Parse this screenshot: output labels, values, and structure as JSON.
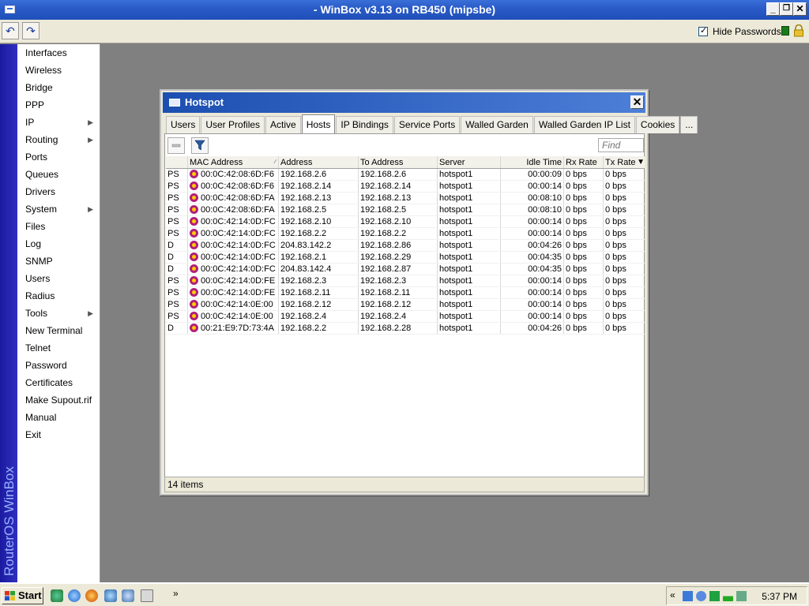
{
  "window": {
    "title": "- WinBox v3.13 on RB450 (mipsbe)"
  },
  "toolbar": {
    "hide_passwords_label": "Hide Passwords",
    "hide_passwords_checked": true
  },
  "side_strip": {
    "brand": "RouterOS WinBox"
  },
  "menu": {
    "items": [
      {
        "label": "Interfaces",
        "submenu": false
      },
      {
        "label": "Wireless",
        "submenu": false
      },
      {
        "label": "Bridge",
        "submenu": false
      },
      {
        "label": "PPP",
        "submenu": false
      },
      {
        "label": "IP",
        "submenu": true
      },
      {
        "label": "Routing",
        "submenu": true
      },
      {
        "label": "Ports",
        "submenu": false
      },
      {
        "label": "Queues",
        "submenu": false
      },
      {
        "label": "Drivers",
        "submenu": false
      },
      {
        "label": "System",
        "submenu": true
      },
      {
        "label": "Files",
        "submenu": false
      },
      {
        "label": "Log",
        "submenu": false
      },
      {
        "label": "SNMP",
        "submenu": false
      },
      {
        "label": "Users",
        "submenu": false
      },
      {
        "label": "Radius",
        "submenu": false
      },
      {
        "label": "Tools",
        "submenu": true
      },
      {
        "label": "New Terminal",
        "submenu": false
      },
      {
        "label": "Telnet",
        "submenu": false
      },
      {
        "label": "Password",
        "submenu": false
      },
      {
        "label": "Certificates",
        "submenu": false
      },
      {
        "label": "Make Supout.rif",
        "submenu": false
      },
      {
        "label": "Manual",
        "submenu": false
      },
      {
        "label": "Exit",
        "submenu": false
      }
    ]
  },
  "hotspot": {
    "title": "Hotspot",
    "tabs": [
      "Users",
      "User Profiles",
      "Active",
      "Hosts",
      "IP Bindings",
      "Service Ports",
      "Walled Garden",
      "Walled Garden IP List",
      "Cookies",
      "..."
    ],
    "active_tab": "Hosts",
    "find_placeholder": "Find",
    "columns": [
      "",
      "MAC Address",
      "Address",
      "To Address",
      "Server",
      "Idle Time",
      "Rx Rate",
      "Tx Rate"
    ],
    "rows": [
      [
        "PS",
        "00:0C:42:08:6D:F6",
        "192.168.2.6",
        "192.168.2.6",
        "hotspot1",
        "00:00:09",
        "0 bps",
        "0 bps"
      ],
      [
        "PS",
        "00:0C:42:08:6D:F6",
        "192.168.2.14",
        "192.168.2.14",
        "hotspot1",
        "00:00:14",
        "0 bps",
        "0 bps"
      ],
      [
        "PS",
        "00:0C:42:08:6D:FA",
        "192.168.2.13",
        "192.168.2.13",
        "hotspot1",
        "00:08:10",
        "0 bps",
        "0 bps"
      ],
      [
        "PS",
        "00:0C:42:08:6D:FA",
        "192.168.2.5",
        "192.168.2.5",
        "hotspot1",
        "00:08:10",
        "0 bps",
        "0 bps"
      ],
      [
        "PS",
        "00:0C:42:14:0D:FC",
        "192.168.2.10",
        "192.168.2.10",
        "hotspot1",
        "00:00:14",
        "0 bps",
        "0 bps"
      ],
      [
        "PS",
        "00:0C:42:14:0D:FC",
        "192.168.2.2",
        "192.168.2.2",
        "hotspot1",
        "00:00:14",
        "0 bps",
        "0 bps"
      ],
      [
        "D",
        "00:0C:42:14:0D:FC",
        "204.83.142.2",
        "192.168.2.86",
        "hotspot1",
        "00:04:26",
        "0 bps",
        "0 bps"
      ],
      [
        "D",
        "00:0C:42:14:0D:FC",
        "192.168.2.1",
        "192.168.2.29",
        "hotspot1",
        "00:04:35",
        "0 bps",
        "0 bps"
      ],
      [
        "D",
        "00:0C:42:14:0D:FC",
        "204.83.142.4",
        "192.168.2.87",
        "hotspot1",
        "00:04:35",
        "0 bps",
        "0 bps"
      ],
      [
        "PS",
        "00:0C:42:14:0D:FE",
        "192.168.2.3",
        "192.168.2.3",
        "hotspot1",
        "00:00:14",
        "0 bps",
        "0 bps"
      ],
      [
        "PS",
        "00:0C:42:14:0D:FE",
        "192.168.2.11",
        "192.168.2.11",
        "hotspot1",
        "00:00:14",
        "0 bps",
        "0 bps"
      ],
      [
        "PS",
        "00:0C:42:14:0E:00",
        "192.168.2.12",
        "192.168.2.12",
        "hotspot1",
        "00:00:14",
        "0 bps",
        "0 bps"
      ],
      [
        "PS",
        "00:0C:42:14:0E:00",
        "192.168.2.4",
        "192.168.2.4",
        "hotspot1",
        "00:00:14",
        "0 bps",
        "0 bps"
      ],
      [
        "D",
        "00:21:E9:7D:73:4A",
        "192.168.2.2",
        "192.168.2.28",
        "hotspot1",
        "00:04:26",
        "0 bps",
        "0 bps"
      ]
    ],
    "status": "14 items"
  },
  "taskbar": {
    "start_label": "Start",
    "clock": "5:37 PM",
    "chevron": "»",
    "tray_chevron": "«"
  },
  "colors": {
    "title_bar": "#2a5bc8",
    "side_strip": "#2020b0",
    "desktop": "#808080",
    "host_icon": "#b0207a"
  }
}
